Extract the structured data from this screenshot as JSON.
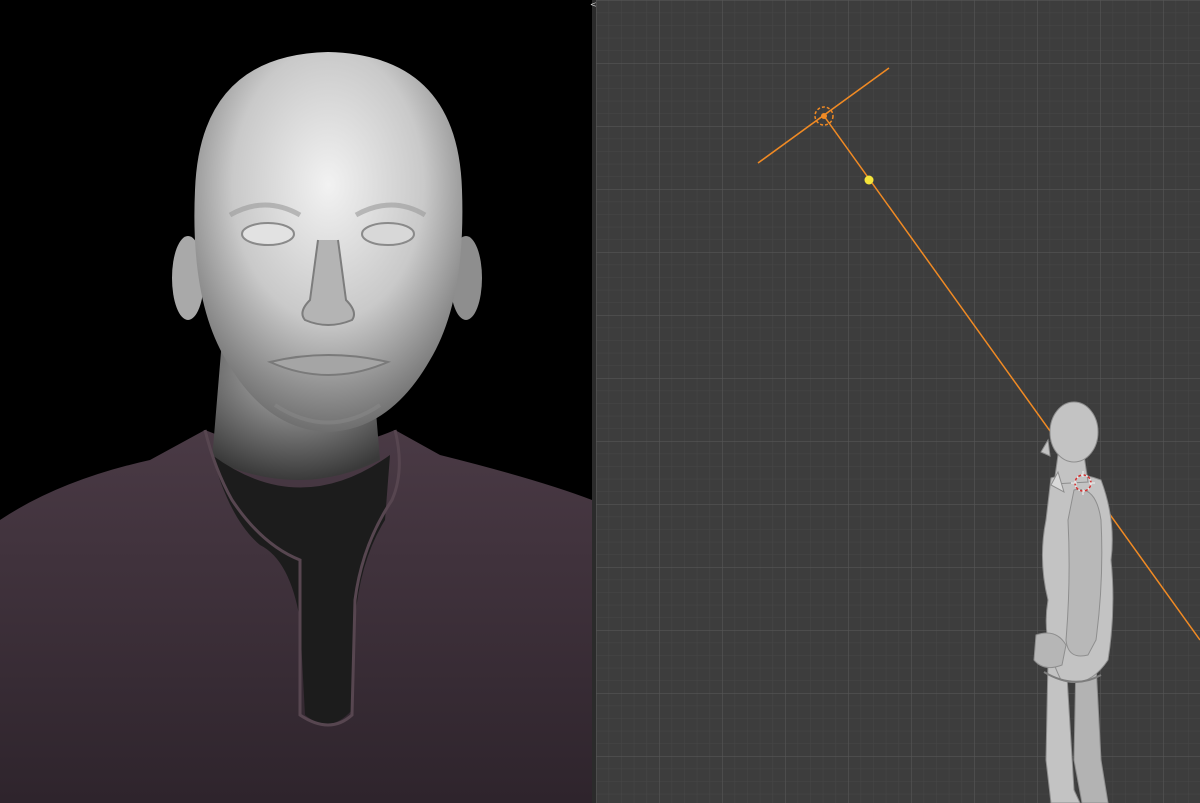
{
  "app": {
    "left_panel": "render-preview",
    "right_panel": "3d-viewport-orthographic-side"
  },
  "splitter": {
    "icon": "resize-arrows-icon",
    "glyph": "<>"
  },
  "colors": {
    "render_background": "#000000",
    "viewport_background": "#3d3d3d",
    "grid_minor": "#474747",
    "grid_major": "#525252",
    "selection_orange": "#f08a24",
    "light_handle_yellow": "#f5e43a",
    "shirt_color": "#3d3039",
    "skin_color": "#c9c9c9"
  },
  "scene": {
    "selected_object": "spot-light",
    "subject": "human-bust-model"
  }
}
